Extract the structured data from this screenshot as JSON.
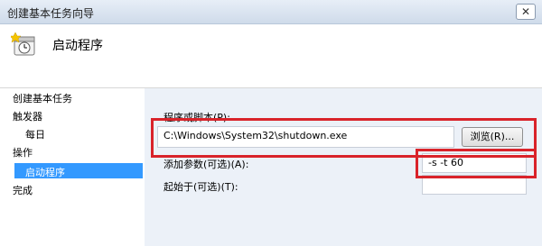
{
  "window": {
    "title": "创建基本任务向导",
    "close_icon": "close-icon",
    "close_glyph": "✕"
  },
  "header": {
    "icon": "task-scheduler-icon",
    "title": "启动程序"
  },
  "sidebar": {
    "section_title": "创建基本任务",
    "items": [
      {
        "label": "触发器"
      },
      {
        "label": "每日"
      },
      {
        "label": "操作"
      },
      {
        "label": "启动程序",
        "selected": true
      },
      {
        "label": "完成"
      }
    ],
    "selected_color": "#3399ff"
  },
  "form": {
    "program_label": "程序或脚本(P):",
    "program_value": "C:\\Windows\\System32\\shutdown.exe",
    "browse_label": "浏览(R)...",
    "args_label": "添加参数(可选)(A):",
    "args_value": "-s -t 60",
    "startin_label": "起始于(可选)(T):",
    "startin_value": ""
  },
  "annotation_color": "#d9232a"
}
